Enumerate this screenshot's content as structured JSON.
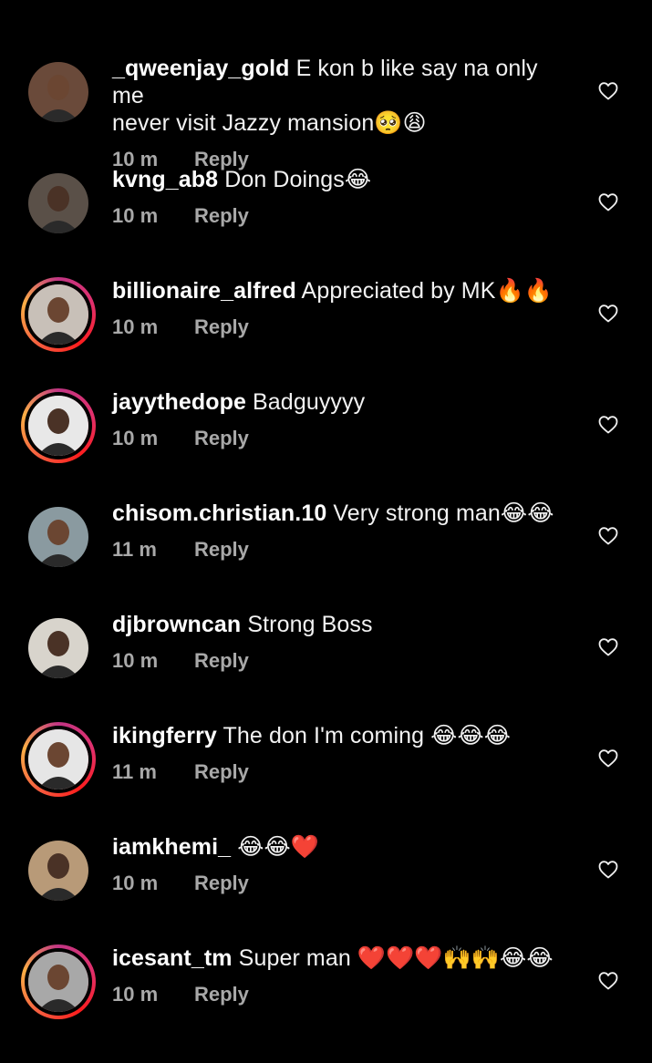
{
  "comments": [
    {
      "username": "_qweenjay_gold",
      "text_line1": "E kon b like say na only me",
      "text_line2": "never visit Jazzy mansion🥺😩",
      "time": "10 m",
      "reply": "Reply",
      "story_ring": false,
      "avatar_color": "#6a4a3a"
    },
    {
      "username": "kvng_ab8",
      "text_line1": "Don Doings😂",
      "text_line2": "",
      "time": "10 m",
      "reply": "Reply",
      "story_ring": false,
      "avatar_color": "#5a5048"
    },
    {
      "username": "billionaire_alfred",
      "text_line1": "Appreciated by MK🔥🔥",
      "text_line2": "",
      "time": "10 m",
      "reply": "Reply",
      "story_ring": true,
      "avatar_color": "#c8c0b8"
    },
    {
      "username": "jayythedope",
      "text_line1": "Badguyyyy",
      "text_line2": "",
      "time": "10 m",
      "reply": "Reply",
      "story_ring": true,
      "avatar_color": "#e8e8e8"
    },
    {
      "username": "chisom.christian.10",
      "text_line1": "Very strong man😂😂",
      "text_line2": "",
      "time": "11 m",
      "reply": "Reply",
      "story_ring": false,
      "avatar_color": "#8a9aa0"
    },
    {
      "username": "djbrowncan",
      "text_line1": "Strong Boss",
      "text_line2": "",
      "time": "10 m",
      "reply": "Reply",
      "story_ring": false,
      "avatar_color": "#d8d4cc"
    },
    {
      "username": "ikingferry",
      "text_line1": "The don I'm coming 😂😂😂",
      "text_line2": "",
      "time": "11 m",
      "reply": "Reply",
      "story_ring": true,
      "avatar_color": "#e6e6e6"
    },
    {
      "username": "iamkhemi_",
      "text_line1": "😂😂❤️",
      "text_line2": "",
      "time": "10 m",
      "reply": "Reply",
      "story_ring": false,
      "avatar_color": "#b89a78"
    },
    {
      "username": "icesant_tm",
      "text_line1": "Super man ❤️❤️❤️🙌🙌😂😂",
      "text_line2": "",
      "time": "10 m",
      "reply": "Reply",
      "story_ring": true,
      "avatar_color": "#a8a8a8"
    }
  ]
}
